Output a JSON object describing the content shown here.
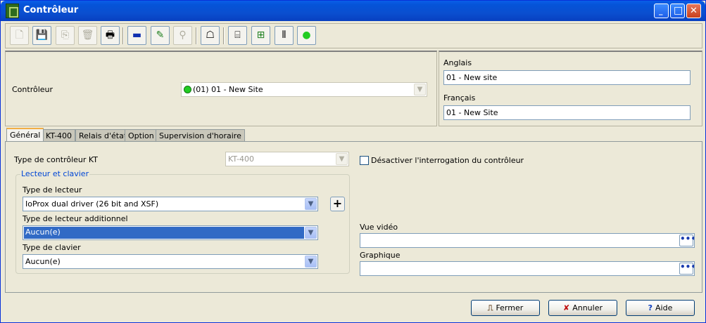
{
  "window": {
    "title": "Contrôleur",
    "title_icon": "controller-app-icon"
  },
  "window_controls": {
    "minimize": "_",
    "maximize": "□",
    "close": "✕"
  },
  "toolbar": {
    "buttons": [
      {
        "name": "new-icon",
        "glyph": "🗋"
      },
      {
        "name": "save-icon",
        "glyph": "💾"
      },
      {
        "name": "copy-icon",
        "glyph": "⎘"
      },
      {
        "name": "delete-icon",
        "glyph": "🗑"
      },
      {
        "name": "print-icon",
        "glyph": "🖶"
      },
      {
        "name": "link-icon",
        "glyph": "▬"
      },
      {
        "name": "edit-icon",
        "glyph": "✎"
      },
      {
        "name": "find-icon",
        "glyph": "⚲"
      },
      {
        "name": "report-icon",
        "glyph": "☖"
      },
      {
        "name": "door-icon",
        "glyph": "⌸"
      },
      {
        "name": "reader-icon",
        "glyph": "⊞"
      },
      {
        "name": "relay-icon",
        "glyph": "⦀"
      },
      {
        "name": "status-icon",
        "glyph": "●"
      }
    ]
  },
  "header": {
    "controller_label": "Contrôleur",
    "controller_value": "(01) 01 - New Site",
    "english_label": "Anglais",
    "english_value": "01 - New site",
    "french_label": "Français",
    "french_value": "01 - New Site"
  },
  "tabs": [
    {
      "label": "Général"
    },
    {
      "label": "KT-400"
    },
    {
      "label": "Relais d'état"
    },
    {
      "label": "Option"
    },
    {
      "label": "Supervision d'horaire"
    }
  ],
  "general": {
    "controller_type_label": "Type de contrôleur KT",
    "controller_type_value": "KT-400",
    "disable_polling_label": "Désactiver l'interrogation du contrôleur",
    "group_title": "Lecteur et clavier",
    "reader_type_label": "Type de lecteur",
    "reader_type_value": "IoProx dual driver (26 bit and XSF)",
    "additional_reader_label": "Type de lecteur additionnel",
    "additional_reader_value": "Aucun(e)",
    "keypad_type_label": "Type de clavier",
    "keypad_type_value": "Aucun(e)",
    "video_label": "Vue vidéo",
    "video_value": "",
    "graphic_label": "Graphique",
    "graphic_value": "",
    "dots": "•••",
    "plus": "+"
  },
  "footer": {
    "close_label": "Fermer",
    "cancel_label": "Annuler",
    "help_label": "Aide"
  },
  "colors": {
    "titlebar": "#0a4fd0",
    "selection": "#316ac5",
    "status_green": "#22cc22"
  }
}
